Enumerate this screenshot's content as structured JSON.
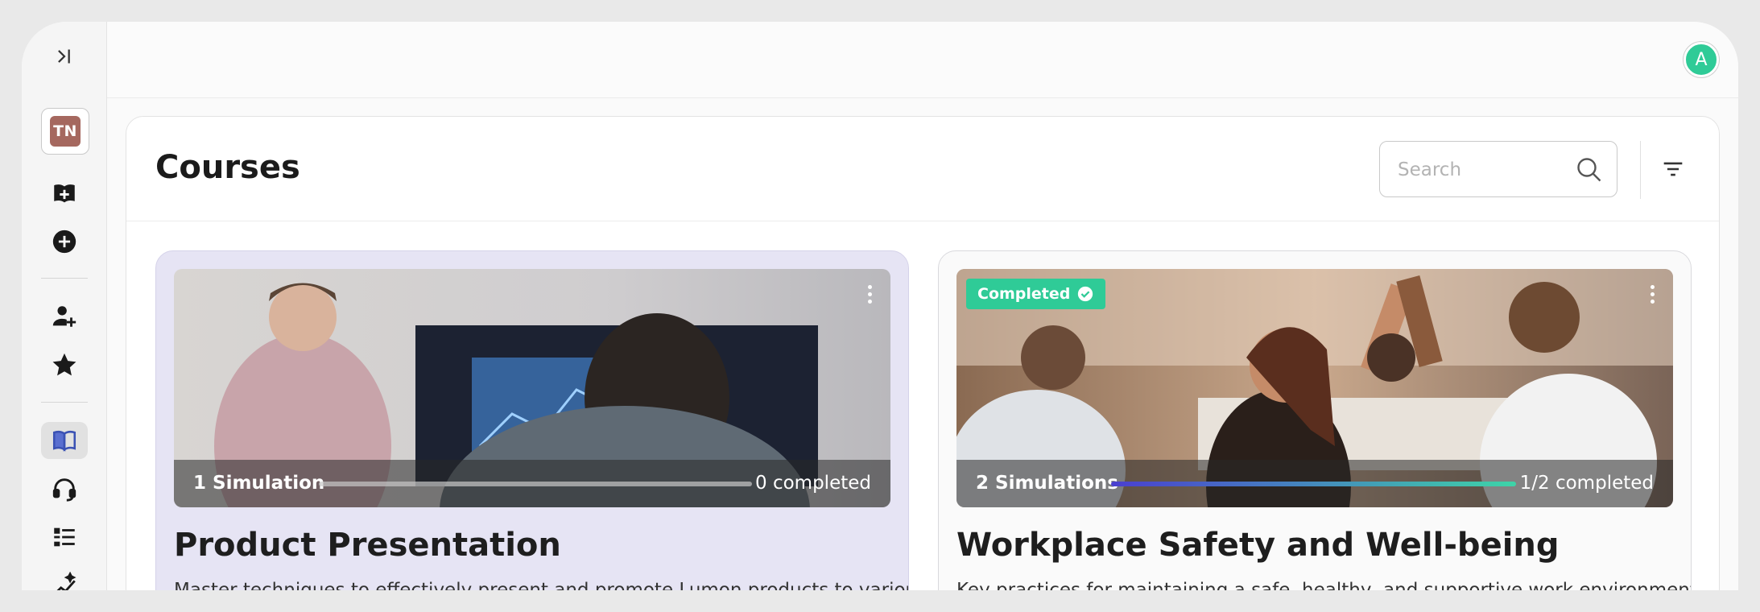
{
  "app": {
    "user_initial": "A",
    "org_initials": "TN"
  },
  "header": {
    "title": "Courses",
    "search": {
      "placeholder": "Search",
      "value": ""
    }
  },
  "sidebar": {
    "icons": [
      "collapse-sidebar-icon",
      "add-course-icon",
      "add-circle-icon",
      "add-user-icon",
      "star-icon",
      "book-icon",
      "headset-icon",
      "list-icon",
      "sparkle-chart-icon"
    ],
    "active": "book-icon"
  },
  "courses": [
    {
      "simulations_label": "1 Simulation",
      "completed_label": "0 completed",
      "progress": 0,
      "title": "Product Presentation",
      "description": "Master techniques to effectively present and promote Lumon products to various",
      "completed_badge": ""
    },
    {
      "simulations_label": "2 Simulations",
      "completed_label": "1/2 completed",
      "progress": 0.5,
      "title": "Workplace Safety and Well-being",
      "description": "Key practices for maintaining a safe, healthy, and supportive work environment",
      "completed_badge": "Completed"
    }
  ],
  "colors": {
    "accent_green": "#2fcb97",
    "progress_start": "#4a3fd0",
    "progress_end": "#3ed4a8",
    "selected_card_bg": "#e6e4f4"
  }
}
